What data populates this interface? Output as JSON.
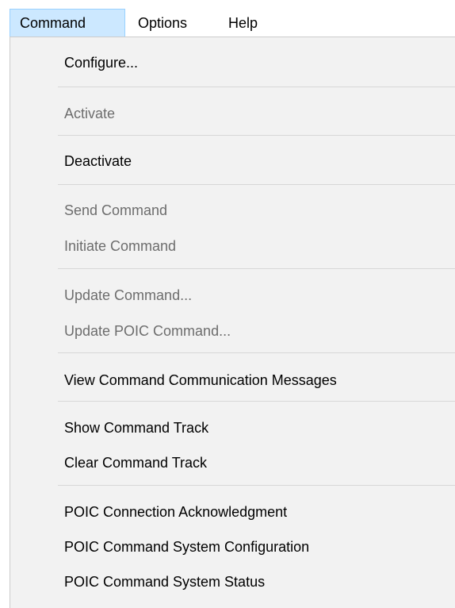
{
  "menubar": {
    "items": [
      {
        "label": "Command",
        "active": true
      },
      {
        "label": "Options",
        "active": false
      },
      {
        "label": "Help",
        "active": false
      }
    ]
  },
  "menu": {
    "items": [
      {
        "label": "Configure...",
        "enabled": true
      },
      {
        "label": "Activate",
        "enabled": false
      },
      {
        "label": "Deactivate",
        "enabled": true
      },
      {
        "label": "Send Command",
        "enabled": false
      },
      {
        "label": "Initiate Command",
        "enabled": false
      },
      {
        "label": "Update Command...",
        "enabled": false
      },
      {
        "label": "Update POIC Command...",
        "enabled": false
      },
      {
        "label": "View Command Communication Messages",
        "enabled": true
      },
      {
        "label": "Show Command Track",
        "enabled": true
      },
      {
        "label": "Clear Command Track",
        "enabled": true
      },
      {
        "label": "POIC Connection Acknowledgment",
        "enabled": true
      },
      {
        "label": "POIC Command System Configuration",
        "enabled": true
      },
      {
        "label": "POIC Command System Status",
        "enabled": true
      }
    ]
  },
  "colors": {
    "menu_background": "#f2f2f2",
    "active_menubar_item": "#cce8ff",
    "disabled_text": "#6d6d6d",
    "separator": "#d7d7d7"
  }
}
